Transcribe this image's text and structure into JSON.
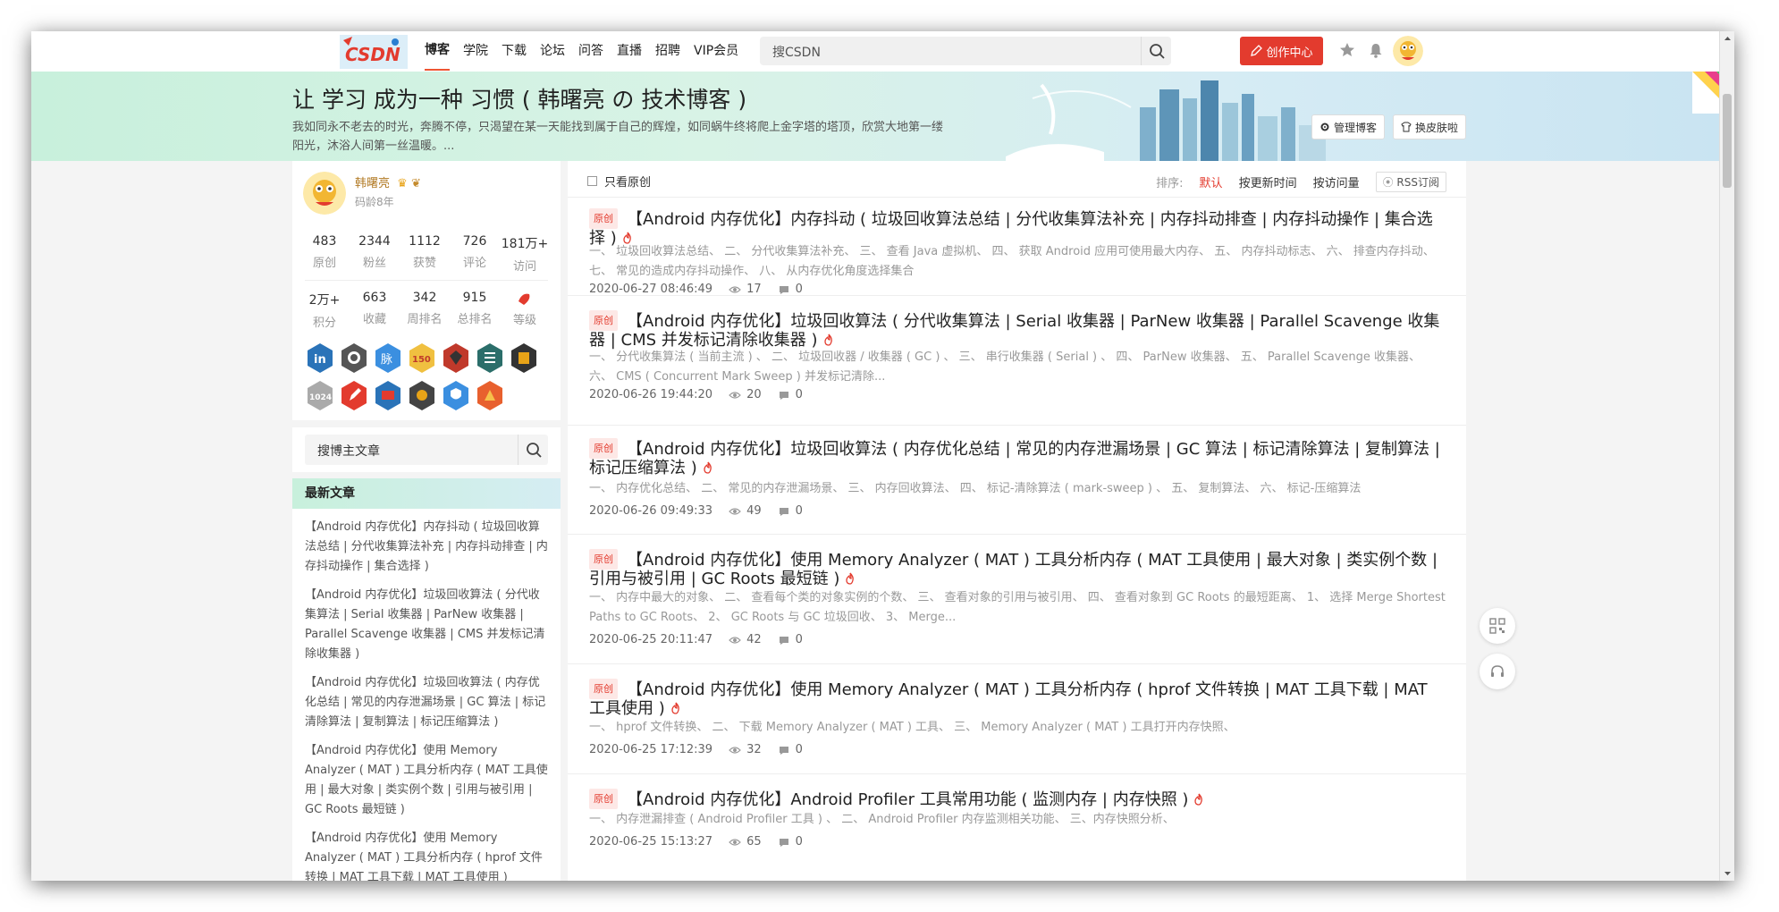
{
  "topbar": {
    "logo_text": "CSDN",
    "nav": [
      "博客",
      "学院",
      "下载",
      "论坛",
      "问答",
      "直播",
      "招聘",
      "VIP会员"
    ],
    "search_placeholder": "搜CSDN",
    "create_label": "创作中心"
  },
  "banner": {
    "title": "让 学习 成为一种 习惯 ( 韩曙亮 の 技术博客 )",
    "desc": "我如同永不老去的时光，奔腾不停，只渴望在某一天能找到属于自己的辉煌，如同蜗牛终将爬上金字塔的塔顶，欣赏大地第一缕阳光，沐浴人间第一丝温暖。...",
    "manage_label": "管理博客",
    "skin_label": "换皮肤啦"
  },
  "profile": {
    "name": "韩曙亮",
    "age": "码龄8年",
    "stats1": [
      {
        "value": "483",
        "label": "原创"
      },
      {
        "value": "2344",
        "label": "粉丝"
      },
      {
        "value": "1112",
        "label": "获赞"
      },
      {
        "value": "726",
        "label": "评论"
      },
      {
        "value": "181万+",
        "label": "访问"
      }
    ],
    "stats2": [
      {
        "value": "2万+",
        "label": "积分"
      },
      {
        "value": "663",
        "label": "收藏"
      },
      {
        "value": "342",
        "label": "周排名"
      },
      {
        "value": "915",
        "label": "总排名"
      },
      {
        "value": "",
        "label": "等级"
      }
    ],
    "badge_texts": [
      "in",
      "",
      "脉",
      "150",
      "",
      "",
      "",
      "1024",
      "",
      "",
      "",
      "",
      ""
    ]
  },
  "sidebar_search": {
    "placeholder": "搜博主文章"
  },
  "recent": {
    "heading": "最新文章",
    "items": [
      "【Android 内存优化】内存抖动 ( 垃圾回收算法总结 | 分代收集算法补充 | 内存抖动排查 | 内存抖动操作 | 集合选择 )",
      "【Android 内存优化】垃圾回收算法 ( 分代收集算法 | Serial 收集器 | ParNew 收集器 | Parallel Scavenge 收集器 | CMS 并发标记清除收集器 )",
      "【Android 内存优化】垃圾回收算法 ( 内存优化总结 | 常见的内存泄漏场景 | GC 算法 | 标记清除算法 | 复制算法 | 标记压缩算法 )",
      "【Android 内存优化】使用 Memory Analyzer ( MAT ) 工具分析内存 ( MAT 工具使用 | 最大对象 | 类实例个数 | 引用与被引用 | GC Roots 最短链 )",
      "【Android 内存优化】使用 Memory Analyzer ( MAT ) 工具分析内存 ( hprof 文件转换 | MAT 工具下载 | MAT 工具使用 )"
    ]
  },
  "list": {
    "only_original": "只看原创",
    "sort_label": "排序:",
    "sort_default": "默认",
    "sort_time": "按更新时间",
    "sort_views": "按访问量",
    "rss": "RSS订阅",
    "tag": "原创",
    "articles": [
      {
        "title": "【Android 内存优化】内存抖动 ( 垃圾回收算法总结 | 分代收集算法补充 | 内存抖动排查 | 内存抖动操作 | 集合选择 )",
        "desc": "一、 垃圾回收算法总结、 二、 分代收集算法补充、 三、 查看 Java 虚拟机、 四、 获取 Android 应用可使用最大内存、 五、 内存抖动标志、 六、 排查内存抖动、 七、 常见的造成内存抖动操作、 八、 从内存优化角度选择集合",
        "date": "2020-06-27 08:46:49",
        "views": "17",
        "comments": "0"
      },
      {
        "title": "【Android 内存优化】垃圾回收算法 ( 分代收集算法 | Serial 收集器 | ParNew 收集器 | Parallel Scavenge 收集器 | CMS 并发标记清除收集器 )",
        "desc": "一、 分代收集算法 ( 当前主流 ) 、 二、 垃圾回收器 / 收集器 ( GC ) 、 三、 串行收集器 ( Serial ) 、 四、 ParNew 收集器、 五、 Parallel Scavenge 收集器、 六、 CMS ( Concurrent Mark Sweep ) 并发标记清除...",
        "date": "2020-06-26 19:44:20",
        "views": "20",
        "comments": "0"
      },
      {
        "title": "【Android 内存优化】垃圾回收算法 ( 内存优化总结 | 常见的内存泄漏场景 | GC 算法 | 标记清除算法 | 复制算法 | 标记压缩算法 )",
        "desc": "一、 内存优化总结、 二、 常见的内存泄漏场景、 三、 内存回收算法、 四、 标记-清除算法 ( mark-sweep ) 、 五、 复制算法、 六、 标记-压缩算法",
        "date": "2020-06-26 09:49:33",
        "views": "49",
        "comments": "0"
      },
      {
        "title": "【Android 内存优化】使用 Memory Analyzer ( MAT ) 工具分析内存 ( MAT 工具使用 | 最大对象 | 类实例个数 | 引用与被引用 | GC Roots 最短链 )",
        "desc": "一、 内存中最大的对象、 二、 查看每个类的对象实例的个数、 三、 查看对象的引用与被引用、 四、 查看对象到 GC Roots 的最短距离、 1、 选择 Merge Shortest Paths to GC Roots、 2、 GC Roots 与 GC 垃圾回收、 3、 Merge...",
        "date": "2020-06-25 20:11:47",
        "views": "42",
        "comments": "0"
      },
      {
        "title": "【Android 内存优化】使用 Memory Analyzer ( MAT ) 工具分析内存 ( hprof 文件转换 | MAT 工具下载 | MAT 工具使用 )",
        "desc": "一、 hprof 文件转换、 二、 下载 Memory Analyzer ( MAT ) 工具、 三、 Memory Analyzer ( MAT ) 工具打开内存快照、",
        "date": "2020-06-25 17:12:39",
        "views": "32",
        "comments": "0"
      },
      {
        "title": "【Android 内存优化】Android Profiler 工具常用功能 ( 监测内存 | 内存快照 )",
        "desc": "一、 内存泄漏排查 ( Android Profiler 工具 ) 、 二、 Android Profiler 内存监测相关功能、 三、内存快照分析、",
        "date": "2020-06-25 15:13:27",
        "views": "65",
        "comments": "0"
      }
    ]
  },
  "colors": {
    "accent": "#e33b2e",
    "banner_start": "#c8f0dc",
    "banner_end": "#c9e4f2"
  }
}
